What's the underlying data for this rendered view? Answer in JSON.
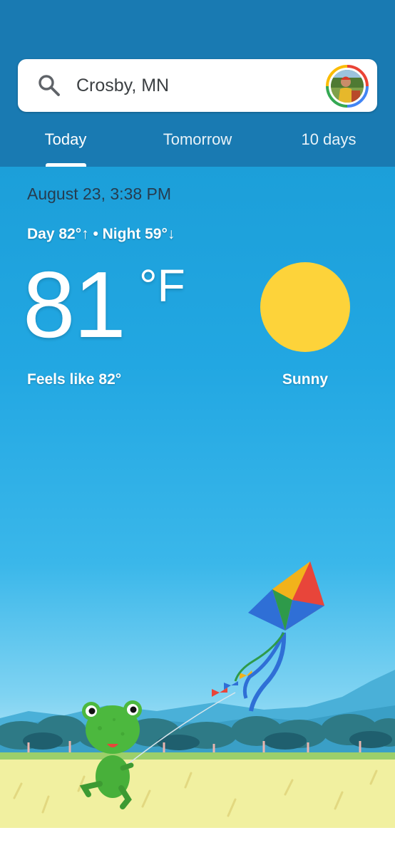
{
  "search": {
    "location": "Crosby, MN"
  },
  "tabs": [
    {
      "label": "Today"
    },
    {
      "label": "Tomorrow"
    },
    {
      "label": "10 days"
    }
  ],
  "weather": {
    "datetime": "August 23, 3:38 PM",
    "day_night": "Day 82°↑ • Night 59°↓",
    "temperature": "81",
    "unit": "°F",
    "feels_like": "Feels like 82°",
    "condition": "Sunny"
  },
  "colors": {
    "header": "#197ab2",
    "sky": "#22a7e2",
    "sun": "#fdd33a",
    "grass": "#f1f0a0"
  },
  "icons": {
    "search": "search-icon",
    "account": "account-avatar"
  }
}
